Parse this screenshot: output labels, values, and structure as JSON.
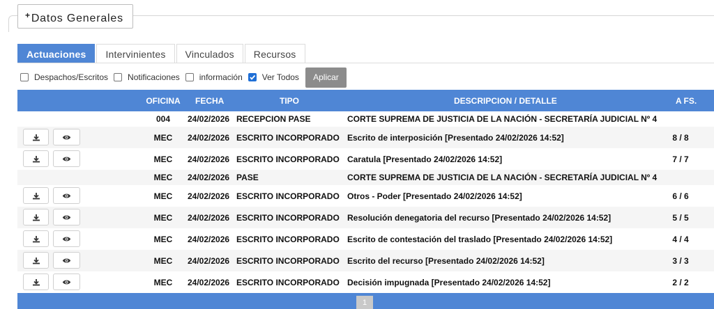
{
  "header": {
    "datos_generales_label": "Datos Generales",
    "plus_glyph": "+"
  },
  "tabs": [
    {
      "label": "Actuaciones",
      "active": true
    },
    {
      "label": "Intervinientes",
      "active": false
    },
    {
      "label": "Vinculados",
      "active": false
    },
    {
      "label": "Recursos",
      "active": false
    }
  ],
  "filters": {
    "items": [
      {
        "label": "Despachos/Escritos",
        "checked": false
      },
      {
        "label": "Notificaciones",
        "checked": false
      },
      {
        "label": "información",
        "checked": false
      },
      {
        "label": "Ver Todos",
        "checked": true
      }
    ],
    "apply_label": "Aplicar"
  },
  "table": {
    "columns": {
      "oficina": "OFICINA",
      "fecha": "FECHA",
      "tipo": "TIPO",
      "descripcion": "DESCRIPCION / DETALLE",
      "afs": "A FS."
    },
    "rows": [
      {
        "oficina": "004",
        "fecha": "24/02/2026",
        "tipo": "RECEPCION PASE",
        "descripcion": "CORTE SUPREMA DE JUSTICIA DE LA NACIÓN - SECRETARÍA JUDICIAL Nº 4",
        "afs": "",
        "actions": false
      },
      {
        "oficina": "MEC",
        "fecha": "24/02/2026",
        "tipo": "ESCRITO INCORPORADO",
        "descripcion": "Escrito de interposición [Presentado 24/02/2026 14:52]",
        "afs": "8 / 8",
        "actions": true
      },
      {
        "oficina": "MEC",
        "fecha": "24/02/2026",
        "tipo": "ESCRITO INCORPORADO",
        "descripcion": "Caratula [Presentado 24/02/2026 14:52]",
        "afs": "7 / 7",
        "actions": true
      },
      {
        "oficina": "MEC",
        "fecha": "24/02/2026",
        "tipo": "PASE",
        "descripcion": "CORTE SUPREMA DE JUSTICIA DE LA NACIÓN - SECRETARÍA JUDICIAL Nº 4",
        "afs": "",
        "actions": false
      },
      {
        "oficina": "MEC",
        "fecha": "24/02/2026",
        "tipo": "ESCRITO INCORPORADO",
        "descripcion": "Otros - Poder [Presentado 24/02/2026 14:52]",
        "afs": "6 / 6",
        "actions": true
      },
      {
        "oficina": "MEC",
        "fecha": "24/02/2026",
        "tipo": "ESCRITO INCORPORADO",
        "descripcion": "Resolución denegatoria del recurso [Presentado 24/02/2026 14:52]",
        "afs": "5 / 5",
        "actions": true
      },
      {
        "oficina": "MEC",
        "fecha": "24/02/2026",
        "tipo": "ESCRITO INCORPORADO",
        "descripcion": "Escrito de contestación del traslado [Presentado 24/02/2026 14:52]",
        "afs": "4 / 4",
        "actions": true
      },
      {
        "oficina": "MEC",
        "fecha": "24/02/2026",
        "tipo": "ESCRITO INCORPORADO",
        "descripcion": "Escrito del recurso [Presentado 24/02/2026 14:52]",
        "afs": "3 / 3",
        "actions": true
      },
      {
        "oficina": "MEC",
        "fecha": "24/02/2026",
        "tipo": "ESCRITO INCORPORADO",
        "descripcion": "Decisión impugnada [Presentado 24/02/2026 14:52]",
        "afs": "2 / 2",
        "actions": true
      }
    ],
    "row_icons": {
      "download": "download-icon",
      "view": "eye-icon"
    }
  },
  "pagination": {
    "current_page": "1"
  },
  "colors": {
    "accent": "#4f86d5",
    "apply_button": "#8c8c8c",
    "checkbox_checked": "#1f6fd6"
  }
}
